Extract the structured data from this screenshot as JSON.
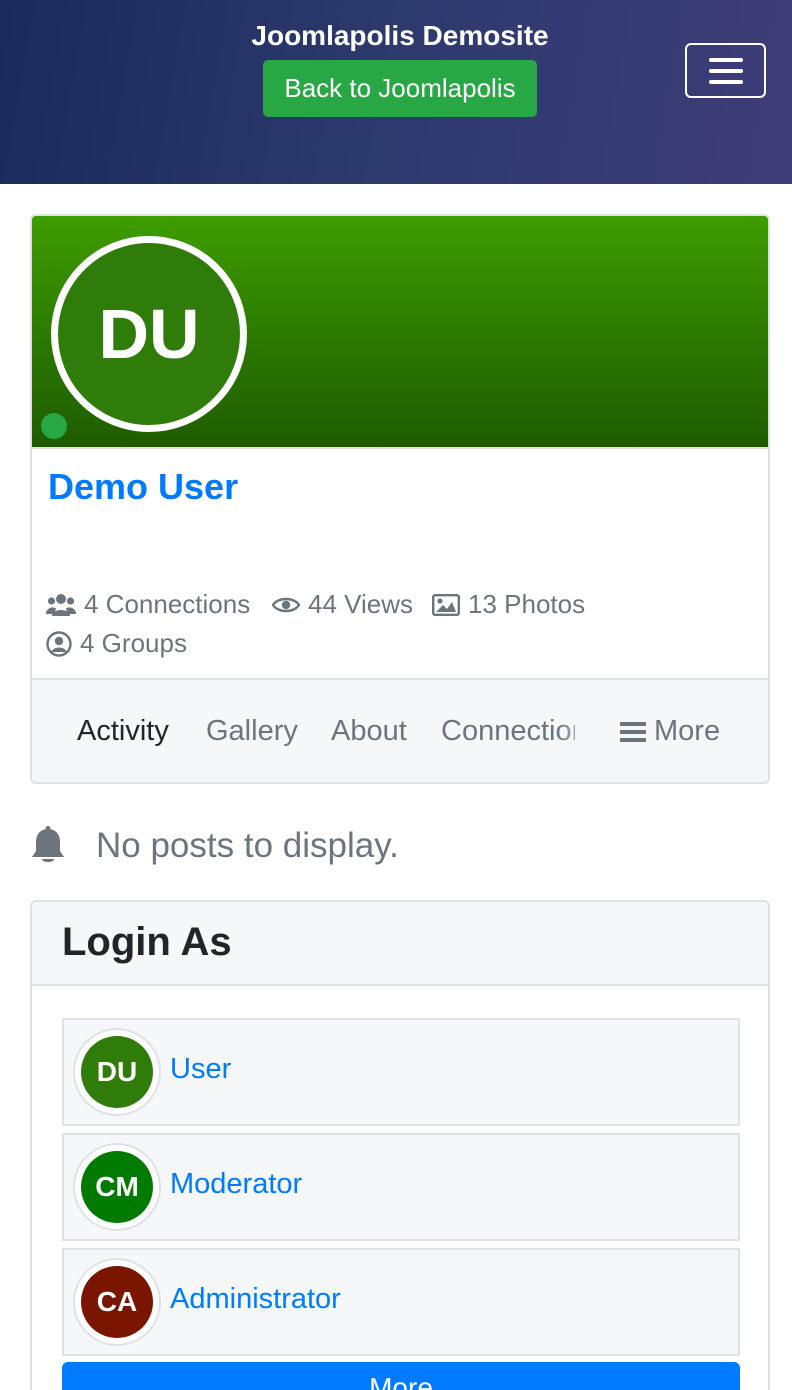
{
  "header": {
    "site_title": "Joomlapolis Demosite",
    "back_button": "Back to Joomlapolis",
    "menu_icon": "hamburger-menu-icon",
    "gradient_colors": [
      "#1a2a5c",
      "#3f3d78"
    ]
  },
  "profile": {
    "initials": "DU",
    "name": "Demo User",
    "online_status_color": "#28a745",
    "cover_color": "#3e9d00",
    "stats": [
      {
        "icon": "users-icon",
        "label": "4 Connections"
      },
      {
        "icon": "eye-icon",
        "label": "44 Views"
      },
      {
        "icon": "image-icon",
        "label": "13 Photos"
      },
      {
        "icon": "user-circle-icon",
        "label": "4 Groups"
      }
    ],
    "tabs": [
      "Activity",
      "Gallery",
      "About",
      "Connections"
    ],
    "more_tab": "More"
  },
  "activity": {
    "empty_text": "No posts to display.",
    "icon": "bell-icon"
  },
  "login_as": {
    "title": "Login As",
    "items": [
      {
        "initials": "DU",
        "label": "User",
        "color": "#2f7c0a"
      },
      {
        "initials": "CM",
        "label": "Moderator",
        "color": "#007a00"
      },
      {
        "initials": "CA",
        "label": "Administrator",
        "color": "#7a1500"
      }
    ],
    "more_button": "More"
  },
  "colors": {
    "link": "#007bff",
    "success": "#28a745",
    "muted": "#6c757d"
  }
}
